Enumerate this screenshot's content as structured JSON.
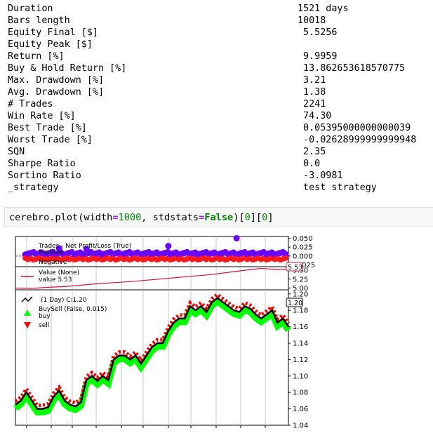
{
  "stats": [
    {
      "key": "Duration",
      "value": "1521 days"
    },
    {
      "key": "Bars length",
      "value": "10018"
    },
    {
      "key": "Equity Final [$]",
      "value": " 5.5256"
    },
    {
      "key": "Equity Peak [$]",
      "value": ""
    },
    {
      "key": "Return [%]",
      "value": " 9.9959"
    },
    {
      "key": "Buy & Hold Return [%]",
      "value": " 13.862653618570775"
    },
    {
      "key": "Max. Drawdown [%]",
      "value": " 3.21"
    },
    {
      "key": "Avg. Drawdown [%]",
      "value": " 1.38"
    },
    {
      "key": "# Trades",
      "value": " 2241"
    },
    {
      "key": "Win Rate [%]",
      "value": " 74.30"
    },
    {
      "key": "Best Trade [%]",
      "value": " 0.05395000000000039"
    },
    {
      "key": "Worst Trade [%]",
      "value": " -0.02628999999999948"
    },
    {
      "key": "SQN",
      "value": " 2.35"
    },
    {
      "key": "Sharpe Ratio",
      "value": " 0.0"
    },
    {
      "key": "Sortino Ratio",
      "value": " -3.0981"
    },
    {
      "key": "_strategy",
      "value": " test strategy"
    }
  ],
  "code_cell": {
    "fn": "cerebro.plot(width",
    "eq1": "=",
    "width_val": "1000",
    "mid": ", stdstats",
    "eq2": "=",
    "kw": "False",
    "close1": ")[",
    "idx1": "0",
    "close2": "][",
    "idx2": "0",
    "close3": "]"
  },
  "chart_data": [
    {
      "type": "scatter",
      "title": "Trades - Net Profit/Loss (True)",
      "legend": [
        "Positive",
        "Negative"
      ],
      "y_ticks": [
        "0.050",
        "0.025",
        "0.000",
        "-0.025"
      ],
      "ylim": [
        -0.03,
        0.055
      ],
      "colors": {
        "positive": "#6a00ff",
        "negative": "#ff1a1a"
      },
      "outliers": [
        {
          "x": 0.81,
          "y": 0.05
        },
        {
          "x": 0.56,
          "y": 0.028
        },
        {
          "x": 0.16,
          "y": 0.022
        },
        {
          "x": 0.26,
          "y": 0.02
        }
      ]
    },
    {
      "type": "line",
      "legend": [
        "Value (None)",
        "value 5.53"
      ],
      "y_ticks": [
        "5.50",
        "5.25",
        "5.00"
      ],
      "ylim": [
        4.95,
        5.6
      ],
      "last_value": "5.53",
      "color": "#d0103a",
      "x": [
        0,
        0.06,
        0.12,
        0.18,
        0.24,
        0.3,
        0.36,
        0.42,
        0.48,
        0.54,
        0.6,
        0.66,
        0.72,
        0.78,
        0.84,
        0.9,
        0.96,
        1.0
      ],
      "y": [
        5.0,
        4.99,
        5.02,
        5.04,
        5.08,
        5.12,
        5.15,
        5.18,
        5.22,
        5.26,
        5.3,
        5.34,
        5.38,
        5.44,
        5.5,
        5.55,
        5.52,
        5.53
      ]
    },
    {
      "type": "line",
      "title": "(1 Day) C:1.20",
      "legend": [
        "(1 Day) C:1.20",
        "BuySell (False, 0.015)",
        "buy",
        "sell"
      ],
      "y_ticks": [
        "1.20",
        "1.18",
        "1.16",
        "1.14",
        "1.12",
        "1.10",
        "1.08",
        "1.06",
        "1.04"
      ],
      "ylim": [
        1.04,
        1.205
      ],
      "last_value": "1.20",
      "colors": {
        "price": "#000000",
        "buy": "#00ff00",
        "sell": "#ff0000"
      },
      "x": [
        0,
        0.02,
        0.04,
        0.06,
        0.08,
        0.1,
        0.12,
        0.14,
        0.16,
        0.18,
        0.2,
        0.22,
        0.24,
        0.26,
        0.28,
        0.3,
        0.32,
        0.34,
        0.36,
        0.38,
        0.4,
        0.42,
        0.44,
        0.46,
        0.48,
        0.5,
        0.52,
        0.54,
        0.56,
        0.58,
        0.6,
        0.62,
        0.64,
        0.66,
        0.68,
        0.7,
        0.72,
        0.74,
        0.76,
        0.78,
        0.8,
        0.82,
        0.84,
        0.86,
        0.88,
        0.9,
        0.92,
        0.94,
        0.96,
        0.98,
        1.0
      ],
      "y": [
        1.065,
        1.07,
        1.08,
        1.07,
        1.06,
        1.06,
        1.062,
        1.075,
        1.082,
        1.07,
        1.065,
        1.063,
        1.068,
        1.095,
        1.1,
        1.094,
        1.1,
        1.095,
        1.12,
        1.125,
        1.125,
        1.12,
        1.125,
        1.115,
        1.125,
        1.135,
        1.14,
        1.14,
        1.155,
        1.165,
        1.17,
        1.17,
        1.185,
        1.18,
        1.185,
        1.178,
        1.19,
        1.195,
        1.19,
        1.185,
        1.18,
        1.178,
        1.185,
        1.182,
        1.175,
        1.17,
        1.175,
        1.18,
        1.165,
        1.17,
        1.16
      ]
    }
  ]
}
